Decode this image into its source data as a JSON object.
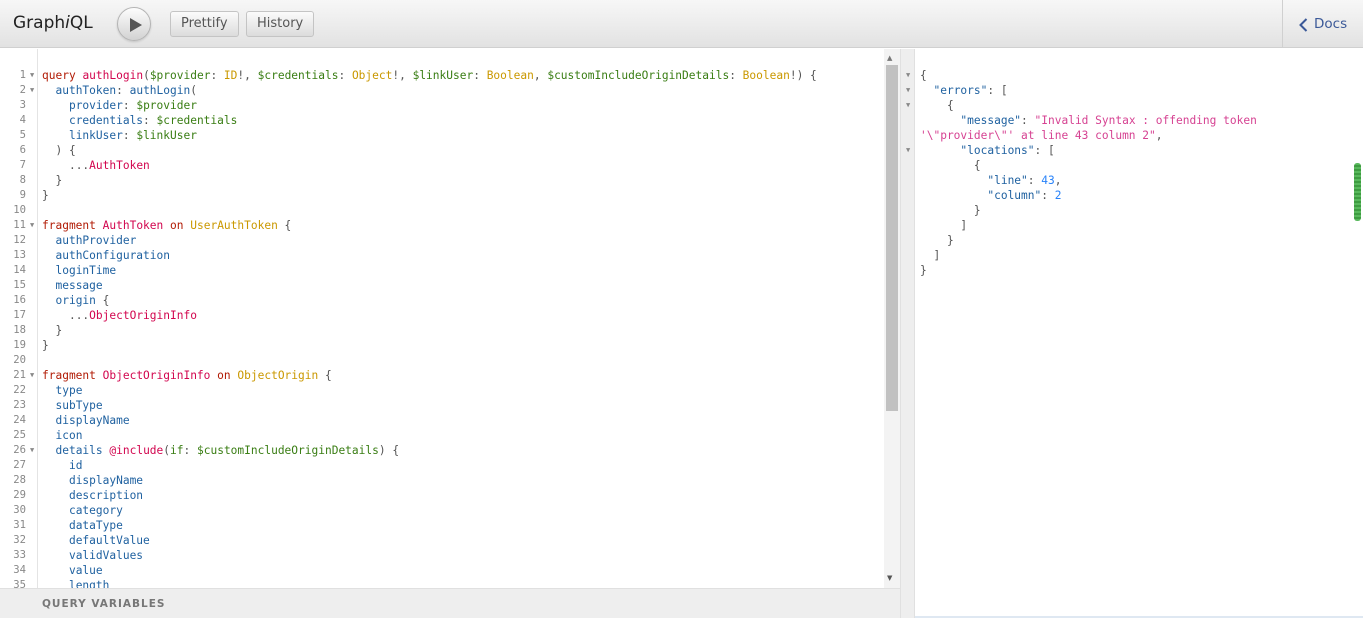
{
  "app": {
    "title_prefix": "Graph",
    "title_italic": "i",
    "title_suffix": "QL"
  },
  "toolbar": {
    "prettify_label": "Prettify",
    "history_label": "History",
    "docs_label": "Docs"
  },
  "editor": {
    "lines": [
      {
        "n": "1",
        "fold": true,
        "tokens": [
          {
            "t": "query",
            "c": "kw"
          },
          {
            "t": " "
          },
          {
            "t": "authLogin",
            "c": "def"
          },
          {
            "t": "(",
            "c": "punc"
          },
          {
            "t": "$provider",
            "c": "var"
          },
          {
            "t": ": ",
            "c": "punc"
          },
          {
            "t": "ID",
            "c": "type"
          },
          {
            "t": "!, ",
            "c": "punc"
          },
          {
            "t": "$credentials",
            "c": "var"
          },
          {
            "t": ": ",
            "c": "punc"
          },
          {
            "t": "Object",
            "c": "type"
          },
          {
            "t": "!, ",
            "c": "punc"
          },
          {
            "t": "$linkUser",
            "c": "var"
          },
          {
            "t": ": ",
            "c": "punc"
          },
          {
            "t": "Boolean",
            "c": "type"
          },
          {
            "t": ", ",
            "c": "punc"
          },
          {
            "t": "$customIncludeOriginDetails",
            "c": "var"
          },
          {
            "t": ": ",
            "c": "punc"
          },
          {
            "t": "Boolean",
            "c": "type"
          },
          {
            "t": "!) {",
            "c": "punc"
          }
        ]
      },
      {
        "n": "2",
        "fold": true,
        "tokens": [
          {
            "t": "  "
          },
          {
            "t": "authToken",
            "c": "prop"
          },
          {
            "t": ": ",
            "c": "punc"
          },
          {
            "t": "authLogin",
            "c": "prop"
          },
          {
            "t": "(",
            "c": "punc"
          }
        ]
      },
      {
        "n": "3",
        "fold": false,
        "tokens": [
          {
            "t": "    "
          },
          {
            "t": "provider",
            "c": "prop"
          },
          {
            "t": ": ",
            "c": "punc"
          },
          {
            "t": "$provider",
            "c": "var"
          }
        ]
      },
      {
        "n": "4",
        "fold": false,
        "tokens": [
          {
            "t": "    "
          },
          {
            "t": "credentials",
            "c": "prop"
          },
          {
            "t": ": ",
            "c": "punc"
          },
          {
            "t": "$credentials",
            "c": "var"
          }
        ]
      },
      {
        "n": "5",
        "fold": false,
        "tokens": [
          {
            "t": "    "
          },
          {
            "t": "linkUser",
            "c": "prop"
          },
          {
            "t": ": ",
            "c": "punc"
          },
          {
            "t": "$linkUser",
            "c": "var"
          }
        ]
      },
      {
        "n": "6",
        "fold": false,
        "tokens": [
          {
            "t": "  "
          },
          {
            "t": ") {",
            "c": "punc"
          }
        ]
      },
      {
        "n": "7",
        "fold": false,
        "tokens": [
          {
            "t": "    "
          },
          {
            "t": "...",
            "c": "punc"
          },
          {
            "t": "AuthToken",
            "c": "def"
          }
        ]
      },
      {
        "n": "8",
        "fold": false,
        "tokens": [
          {
            "t": "  "
          },
          {
            "t": "}",
            "c": "punc"
          }
        ]
      },
      {
        "n": "9",
        "fold": false,
        "tokens": [
          {
            "t": "}",
            "c": "punc"
          }
        ]
      },
      {
        "n": "10",
        "fold": false,
        "tokens": []
      },
      {
        "n": "11",
        "fold": true,
        "tokens": [
          {
            "t": "fragment",
            "c": "kw"
          },
          {
            "t": " "
          },
          {
            "t": "AuthToken",
            "c": "def"
          },
          {
            "t": " "
          },
          {
            "t": "on",
            "c": "kw"
          },
          {
            "t": " "
          },
          {
            "t": "UserAuthToken",
            "c": "type"
          },
          {
            "t": " {",
            "c": "punc"
          }
        ]
      },
      {
        "n": "12",
        "fold": false,
        "tokens": [
          {
            "t": "  "
          },
          {
            "t": "authProvider",
            "c": "prop"
          }
        ]
      },
      {
        "n": "13",
        "fold": false,
        "tokens": [
          {
            "t": "  "
          },
          {
            "t": "authConfiguration",
            "c": "prop"
          }
        ]
      },
      {
        "n": "14",
        "fold": false,
        "tokens": [
          {
            "t": "  "
          },
          {
            "t": "loginTime",
            "c": "prop"
          }
        ]
      },
      {
        "n": "15",
        "fold": false,
        "tokens": [
          {
            "t": "  "
          },
          {
            "t": "message",
            "c": "prop"
          }
        ]
      },
      {
        "n": "16",
        "fold": false,
        "tokens": [
          {
            "t": "  "
          },
          {
            "t": "origin",
            "c": "prop"
          },
          {
            "t": " {",
            "c": "punc"
          }
        ]
      },
      {
        "n": "17",
        "fold": false,
        "tokens": [
          {
            "t": "    "
          },
          {
            "t": "...",
            "c": "punc"
          },
          {
            "t": "ObjectOriginInfo",
            "c": "def"
          }
        ]
      },
      {
        "n": "18",
        "fold": false,
        "tokens": [
          {
            "t": "  "
          },
          {
            "t": "}",
            "c": "punc"
          }
        ]
      },
      {
        "n": "19",
        "fold": false,
        "tokens": [
          {
            "t": "}",
            "c": "punc"
          }
        ]
      },
      {
        "n": "20",
        "fold": false,
        "tokens": []
      },
      {
        "n": "21",
        "fold": true,
        "tokens": [
          {
            "t": "fragment",
            "c": "kw"
          },
          {
            "t": " "
          },
          {
            "t": "ObjectOriginInfo",
            "c": "def"
          },
          {
            "t": " "
          },
          {
            "t": "on",
            "c": "kw"
          },
          {
            "t": " "
          },
          {
            "t": "ObjectOrigin",
            "c": "type"
          },
          {
            "t": " {",
            "c": "punc"
          }
        ]
      },
      {
        "n": "22",
        "fold": false,
        "tokens": [
          {
            "t": "  "
          },
          {
            "t": "type",
            "c": "prop"
          }
        ]
      },
      {
        "n": "23",
        "fold": false,
        "tokens": [
          {
            "t": "  "
          },
          {
            "t": "subType",
            "c": "prop"
          }
        ]
      },
      {
        "n": "24",
        "fold": false,
        "tokens": [
          {
            "t": "  "
          },
          {
            "t": "displayName",
            "c": "prop"
          }
        ]
      },
      {
        "n": "25",
        "fold": false,
        "tokens": [
          {
            "t": "  "
          },
          {
            "t": "icon",
            "c": "prop"
          }
        ]
      },
      {
        "n": "26",
        "fold": true,
        "tokens": [
          {
            "t": "  "
          },
          {
            "t": "details",
            "c": "prop"
          },
          {
            "t": " "
          },
          {
            "t": "@include",
            "c": "def"
          },
          {
            "t": "(",
            "c": "punc"
          },
          {
            "t": "if",
            "c": "var"
          },
          {
            "t": ": ",
            "c": "punc"
          },
          {
            "t": "$customIncludeOriginDetails",
            "c": "var"
          },
          {
            "t": ") {",
            "c": "punc"
          }
        ]
      },
      {
        "n": "27",
        "fold": false,
        "tokens": [
          {
            "t": "    "
          },
          {
            "t": "id",
            "c": "prop"
          }
        ]
      },
      {
        "n": "28",
        "fold": false,
        "tokens": [
          {
            "t": "    "
          },
          {
            "t": "displayName",
            "c": "prop"
          }
        ]
      },
      {
        "n": "29",
        "fold": false,
        "tokens": [
          {
            "t": "    "
          },
          {
            "t": "description",
            "c": "prop"
          }
        ]
      },
      {
        "n": "30",
        "fold": false,
        "tokens": [
          {
            "t": "    "
          },
          {
            "t": "category",
            "c": "prop"
          }
        ]
      },
      {
        "n": "31",
        "fold": false,
        "tokens": [
          {
            "t": "    "
          },
          {
            "t": "dataType",
            "c": "prop"
          }
        ]
      },
      {
        "n": "32",
        "fold": false,
        "tokens": [
          {
            "t": "    "
          },
          {
            "t": "defaultValue",
            "c": "prop"
          }
        ]
      },
      {
        "n": "33",
        "fold": false,
        "tokens": [
          {
            "t": "    "
          },
          {
            "t": "validValues",
            "c": "prop"
          }
        ]
      },
      {
        "n": "34",
        "fold": false,
        "tokens": [
          {
            "t": "    "
          },
          {
            "t": "value",
            "c": "prop"
          }
        ]
      },
      {
        "n": "35",
        "fold": false,
        "tokens": [
          {
            "t": "    "
          },
          {
            "t": "length",
            "c": "prop"
          }
        ]
      }
    ],
    "query_variables_label": "QUERY VARIABLES"
  },
  "result": {
    "lines": [
      {
        "fold": true,
        "tokens": [
          {
            "t": "{",
            "c": "punc"
          }
        ]
      },
      {
        "fold": true,
        "tokens": [
          {
            "t": "  "
          },
          {
            "t": "\"errors\"",
            "c": "key"
          },
          {
            "t": ": [",
            "c": "punc"
          }
        ]
      },
      {
        "fold": true,
        "tokens": [
          {
            "t": "    "
          },
          {
            "t": "{",
            "c": "punc"
          }
        ]
      },
      {
        "fold": false,
        "tokens": [
          {
            "t": "      "
          },
          {
            "t": "\"message\"",
            "c": "key"
          },
          {
            "t": ": ",
            "c": "punc"
          },
          {
            "t": "\"Invalid Syntax : offending token",
            "c": "str"
          }
        ]
      },
      {
        "fold": false,
        "tokens": [
          {
            "t": "'\\\"provider\\\"' at line 43 column 2\"",
            "c": "str"
          },
          {
            "t": ",",
            "c": "punc"
          }
        ]
      },
      {
        "fold": true,
        "tokens": [
          {
            "t": "      "
          },
          {
            "t": "\"locations\"",
            "c": "key"
          },
          {
            "t": ": [",
            "c": "punc"
          }
        ]
      },
      {
        "fold": false,
        "tokens": [
          {
            "t": "        "
          },
          {
            "t": "{",
            "c": "punc"
          }
        ]
      },
      {
        "fold": false,
        "tokens": [
          {
            "t": "          "
          },
          {
            "t": "\"line\"",
            "c": "key"
          },
          {
            "t": ": ",
            "c": "punc"
          },
          {
            "t": "43",
            "c": "num"
          },
          {
            "t": ",",
            "c": "punc"
          }
        ]
      },
      {
        "fold": false,
        "tokens": [
          {
            "t": "          "
          },
          {
            "t": "\"column\"",
            "c": "key"
          },
          {
            "t": ": ",
            "c": "punc"
          },
          {
            "t": "2",
            "c": "num"
          }
        ]
      },
      {
        "fold": false,
        "tokens": [
          {
            "t": "        "
          },
          {
            "t": "}",
            "c": "punc"
          }
        ]
      },
      {
        "fold": false,
        "tokens": [
          {
            "t": "      "
          },
          {
            "t": "]",
            "c": "punc"
          }
        ]
      },
      {
        "fold": false,
        "tokens": [
          {
            "t": "    "
          },
          {
            "t": "}",
            "c": "punc"
          }
        ]
      },
      {
        "fold": false,
        "tokens": [
          {
            "t": "  "
          },
          {
            "t": "]",
            "c": "punc"
          }
        ]
      },
      {
        "fold": false,
        "tokens": [
          {
            "t": "}",
            "c": "punc"
          }
        ]
      }
    ]
  },
  "colors": {
    "keyword": "#b11a04",
    "definition": "#d2054e",
    "variable": "#397d13",
    "property": "#1f61a0",
    "type": "#ca9800",
    "number": "#2882f9",
    "string": "#d64292",
    "docs_link": "#3b5998"
  }
}
